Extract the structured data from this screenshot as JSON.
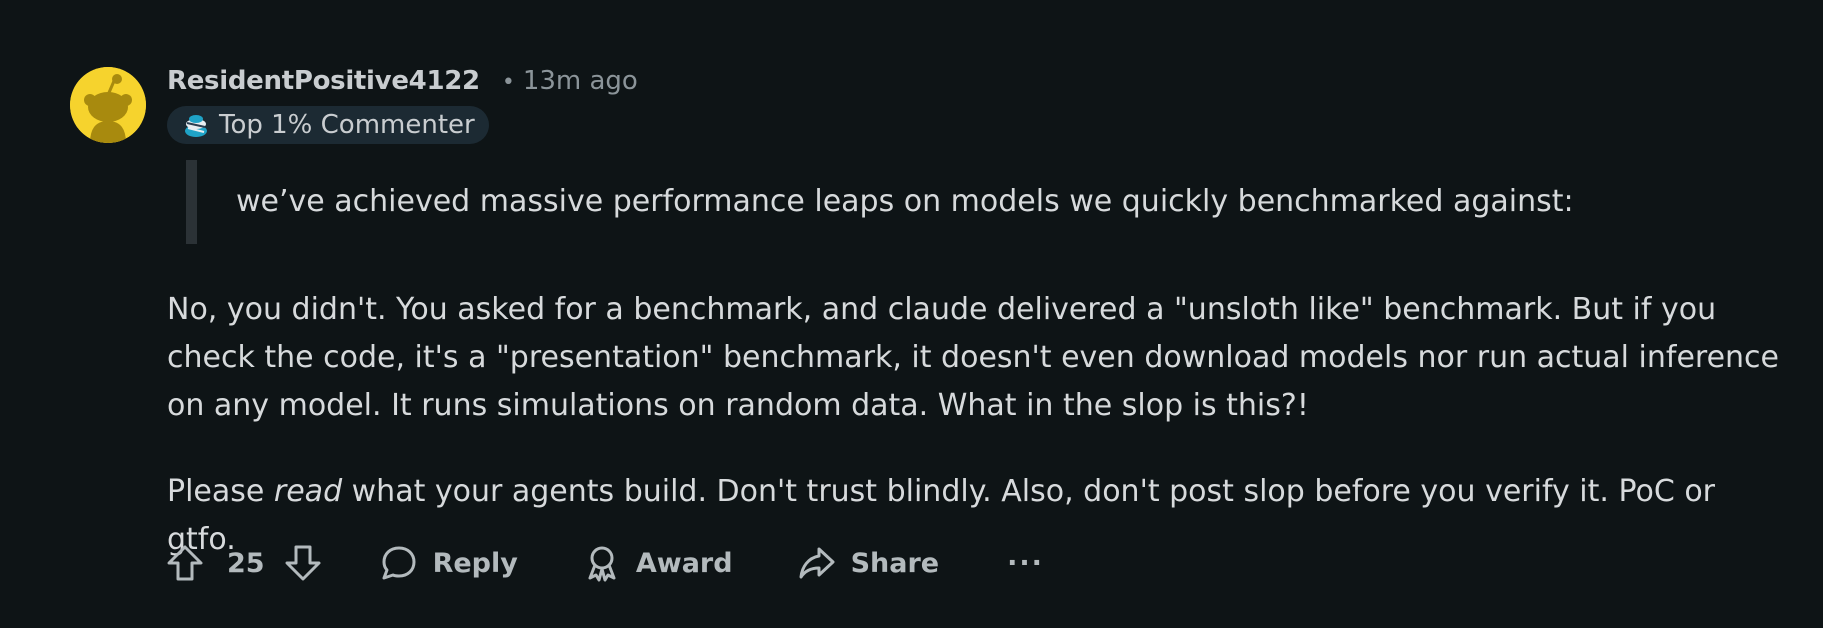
{
  "comment": {
    "username": "ResidentPositive4122",
    "separator": "•",
    "time": "13m ago",
    "badge": {
      "label": "Top 1% Commenter",
      "icon": "top-commenter-icon"
    },
    "quote": "we’ve achieved massive performance leaps on models we quickly benchmarked against:",
    "paragraph1": "No, you didn't. You asked for a benchmark, and claude delivered a \"unsloth like\" benchmark. But if you check the code, it's a \"presentation\" benchmark, it doesn't even download models nor run actual inference on any model. It runs simulations on random data. What in the slop is this?!",
    "paragraph2": {
      "before": "Please ",
      "emphasis": "read",
      "after": " what your agents build. Don't trust blindly. Also, don't post slop before you verify it. PoC or gtfo."
    }
  },
  "actions": {
    "score": "25",
    "reply": "Reply",
    "award": "Award",
    "share": "Share",
    "more": "···"
  },
  "colors": {
    "background": "#0e1416",
    "text": "#d7dadc",
    "muted": "#8b9499",
    "avatar": "#f6d32d",
    "badge_bg": "#1c2a33"
  }
}
